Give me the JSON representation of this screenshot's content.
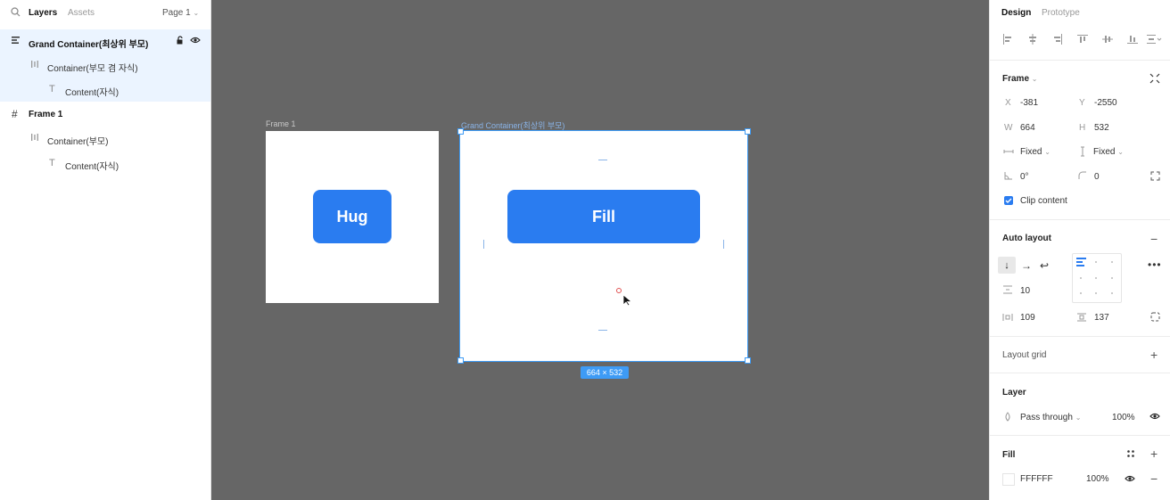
{
  "left_panel": {
    "tabs": [
      "Layers",
      "Assets"
    ],
    "page_selector": "Page 1",
    "layers": [
      {
        "name": "Grand Container(최상위 부모)"
      },
      {
        "name": "Container(부모 겸 자식)"
      },
      {
        "name": "Content(자식)"
      },
      {
        "name": "Frame 1"
      },
      {
        "name": "Container(부모)"
      },
      {
        "name": "Content(자식)"
      }
    ]
  },
  "canvas": {
    "frame1_label": "Frame 1",
    "grand_label": "Grand Container(최상위 부모)",
    "hug_button": "Hug",
    "fill_button": "Fill",
    "size_badge": "664 × 532"
  },
  "right_panel": {
    "tabs": [
      "Design",
      "Prototype"
    ],
    "frame": {
      "title": "Frame",
      "x_label": "X",
      "x": "-381",
      "y_label": "Y",
      "y": "-2550",
      "w_label": "W",
      "w": "664",
      "h_label": "H",
      "h": "532",
      "h_sizing": "Fixed",
      "v_sizing": "Fixed",
      "rotation": "0°",
      "radius": "0",
      "clip_content": "Clip content"
    },
    "auto_layout": {
      "title": "Auto layout",
      "gap": "10",
      "horizontal_padding": "109",
      "vertical_padding": "137"
    },
    "layout_grid": {
      "title": "Layout grid"
    },
    "layer": {
      "title": "Layer",
      "blend": "Pass through",
      "opacity": "100%"
    },
    "fill": {
      "title": "Fill",
      "color": "FFFFFF",
      "opacity": "100%"
    }
  },
  "colors": {
    "accent": "#2a7cf0",
    "selection": "#3e9bf5",
    "canvas": "#666666"
  }
}
